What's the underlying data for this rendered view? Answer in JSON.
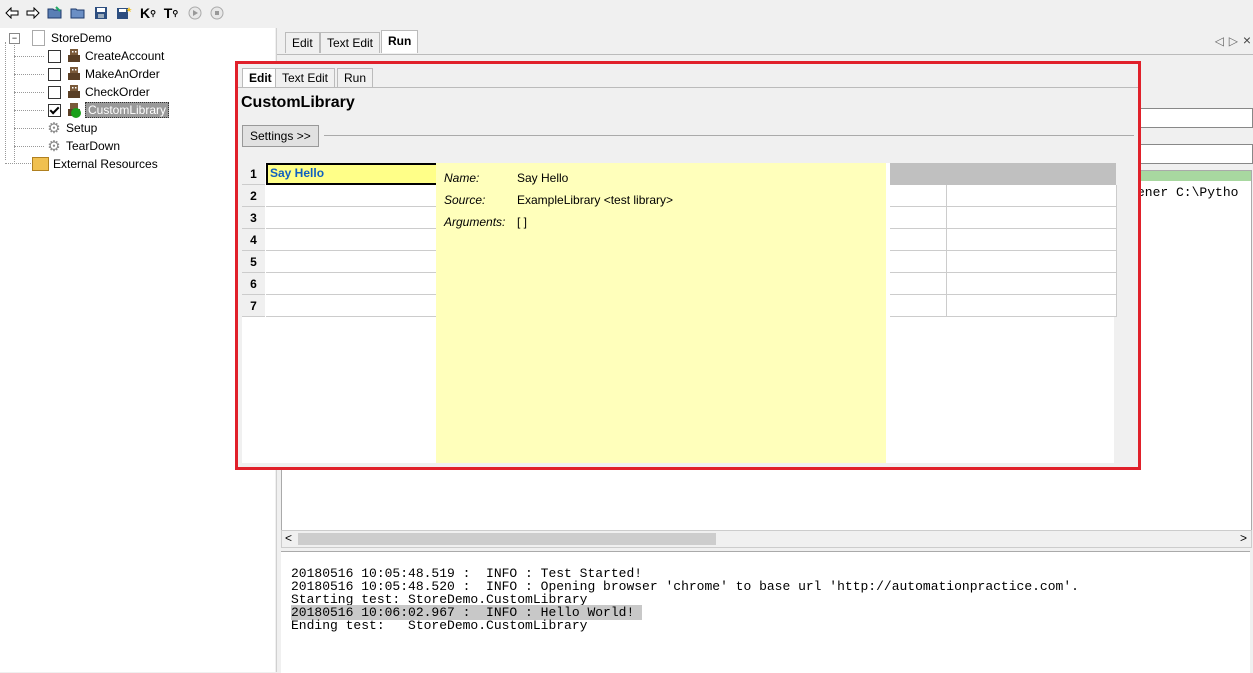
{
  "toolbar": {
    "icons": [
      "back-arrow-icon",
      "forward-arrow-icon",
      "open-suite-icon",
      "open-folder-icon",
      "save-icon",
      "save-all-icon",
      "search-keywords-icon",
      "search-tests-icon",
      "run-icon",
      "stop-icon"
    ],
    "k_glyph": "K",
    "t_glyph": "T"
  },
  "tree": {
    "root": "StoreDemo",
    "items": [
      {
        "label": "CreateAccount",
        "checked": false
      },
      {
        "label": "MakeAnOrder",
        "checked": false
      },
      {
        "label": "CheckOrder",
        "checked": false
      },
      {
        "label": "CustomLibrary",
        "checked": true
      }
    ],
    "setup": "Setup",
    "teardown": "TearDown",
    "external": "External Resources",
    "collapse_glyph": "−"
  },
  "main_tabs": [
    "Edit",
    "Text Edit",
    "Run"
  ],
  "main_active_tab": "Run",
  "run_output_fragment": "ener C:\\Pytho",
  "scroll_left_glyph": "<",
  "scroll_right_glyph": ">",
  "nav_glyphs": {
    "prev": "◁",
    "next": "▷",
    "close": "×"
  },
  "overlay": {
    "tabs": [
      "Edit",
      "Text Edit",
      "Run"
    ],
    "active_tab": "Edit",
    "title": "CustomLibrary",
    "settings_button": "Settings >>",
    "rows": [
      "1",
      "2",
      "3",
      "4",
      "5",
      "6",
      "7"
    ],
    "first_cell": "Say Hello",
    "tooltip": {
      "name_key": "Name:",
      "name_val": "Say Hello",
      "source_key": "Source:",
      "source_val": "ExampleLibrary <test library>",
      "args_key": "Arguments:",
      "args_val": "[ ]"
    }
  },
  "log": [
    "20180516 10:05:48.519 :  INFO : Test Started!",
    "20180516 10:05:48.520 :  INFO : Opening browser 'chrome' to base url 'http://automationpractice.com'.",
    "Starting test: StoreDemo.CustomLibrary",
    "20180516 10:06:02.967 :  INFO : Hello World! ",
    "Ending test:   StoreDemo.CustomLibrary"
  ],
  "colors": {
    "highlight_border": "#e0202a",
    "tooltip_bg": "#ffffbb",
    "cell_yellow": "#ffff88",
    "keyword_blue": "#1060c0",
    "progress_green": "#a8d8a0"
  }
}
